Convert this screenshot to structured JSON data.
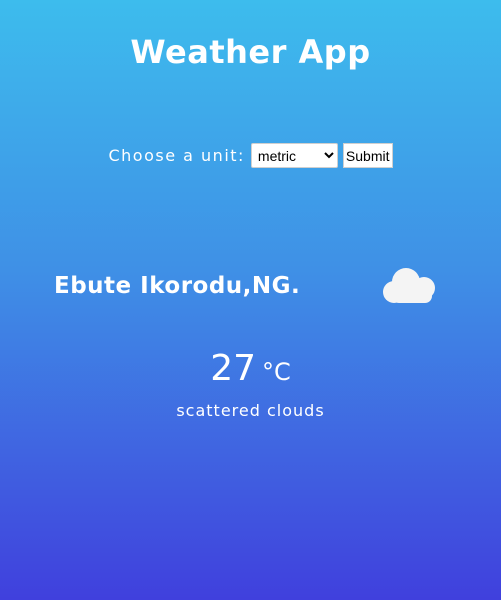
{
  "app": {
    "title": "Weather App"
  },
  "form": {
    "label": "Choose a unit:",
    "selected_unit": "metric",
    "submit_label": "Submit"
  },
  "weather": {
    "location": "Ebute Ikorodu,NG.",
    "icon": "cloud-icon",
    "temperature": "27",
    "unit_symbol": "°C",
    "description": "scattered clouds"
  },
  "colors": {
    "gradient_top": "#3dbced",
    "gradient_bottom": "#4040dd",
    "text": "#ffffff",
    "icon_fill": "#f4f4f4"
  }
}
